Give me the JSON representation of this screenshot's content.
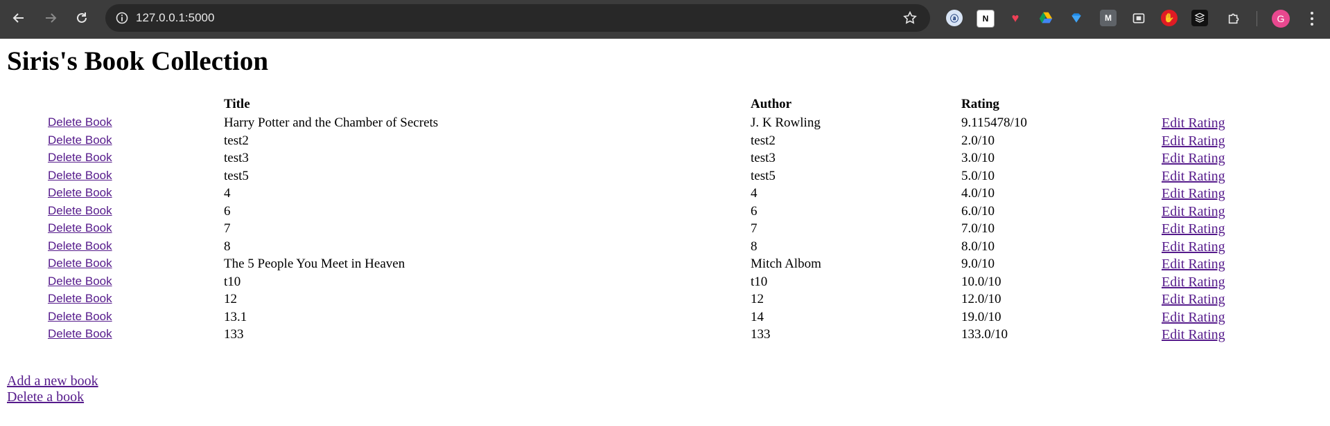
{
  "browser": {
    "url": "127.0.0.1:5000",
    "profile_initial": "G",
    "extensions": [
      "password-manager-icon",
      "notion-icon",
      "pocket-icon",
      "google-drive-icon",
      "sapphire-icon",
      "gmail-icon",
      "screenshot-icon",
      "ublock-icon",
      "stack-icon",
      "puzzle-icon"
    ]
  },
  "page": {
    "title": "Siris's Book Collection",
    "columns": {
      "title": "Title",
      "author": "Author",
      "rating": "Rating"
    },
    "delete_label": "Delete Book",
    "edit_label": "Edit Rating",
    "books": [
      {
        "title": "Harry Potter and the Chamber of Secrets",
        "author": "J. K Rowling",
        "rating": "9.115478/10"
      },
      {
        "title": "test2",
        "author": "test2",
        "rating": "2.0/10"
      },
      {
        "title": "test3",
        "author": "test3",
        "rating": "3.0/10"
      },
      {
        "title": "test5",
        "author": "test5",
        "rating": "5.0/10"
      },
      {
        "title": "4",
        "author": "4",
        "rating": "4.0/10"
      },
      {
        "title": "6",
        "author": "6",
        "rating": "6.0/10"
      },
      {
        "title": "7",
        "author": "7",
        "rating": "7.0/10"
      },
      {
        "title": "8",
        "author": "8",
        "rating": "8.0/10"
      },
      {
        "title": "The 5 People You Meet in Heaven",
        "author": "Mitch Albom",
        "rating": "9.0/10"
      },
      {
        "title": "t10",
        "author": "t10",
        "rating": "10.0/10"
      },
      {
        "title": "12",
        "author": "12",
        "rating": "12.0/10"
      },
      {
        "title": "13.1",
        "author": "14",
        "rating": "19.0/10"
      },
      {
        "title": "133",
        "author": "133",
        "rating": "133.0/10"
      }
    ],
    "add_link": "Add a new book",
    "delete_link": "Delete a book"
  }
}
